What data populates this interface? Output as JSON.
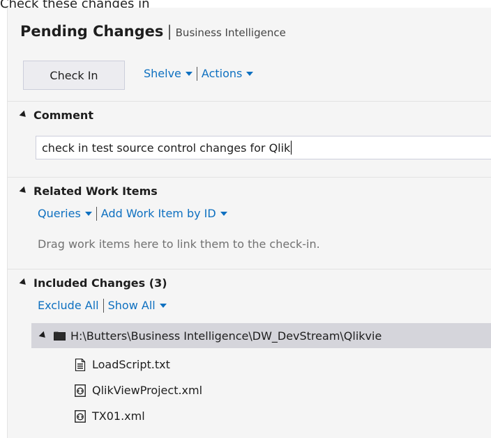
{
  "caption": "Check these changes in",
  "header": {
    "title": "Pending Changes",
    "separator": "|",
    "subtitle": "Business Intelligence"
  },
  "toolbar": {
    "checkin_label": "Check In",
    "shelve_label": "Shelve",
    "actions_label": "Actions"
  },
  "comment_section": {
    "heading": "Comment",
    "value": "check in test source control changes for Qlik"
  },
  "work_items_section": {
    "heading": "Related Work Items",
    "queries_label": "Queries",
    "add_by_id_label": "Add Work Item by ID",
    "hint": "Drag work items here to link them to the check-in."
  },
  "included_section": {
    "heading": "Included Changes (3)",
    "exclude_all_label": "Exclude All",
    "show_all_label": "Show All",
    "folder_path": "H:\\Butters\\Business Intelligence\\DW_DevStream\\Qlikvie",
    "files": [
      {
        "name": "LoadScript.txt",
        "icon": "text-file-icon"
      },
      {
        "name": "QlikViewProject.xml",
        "icon": "xml-file-icon"
      },
      {
        "name": "TX01.xml",
        "icon": "xml-file-icon"
      }
    ]
  },
  "colors": {
    "link": "#0e70c0",
    "panel_bg": "#f5f5f5",
    "selected_row": "#d5d5db"
  }
}
